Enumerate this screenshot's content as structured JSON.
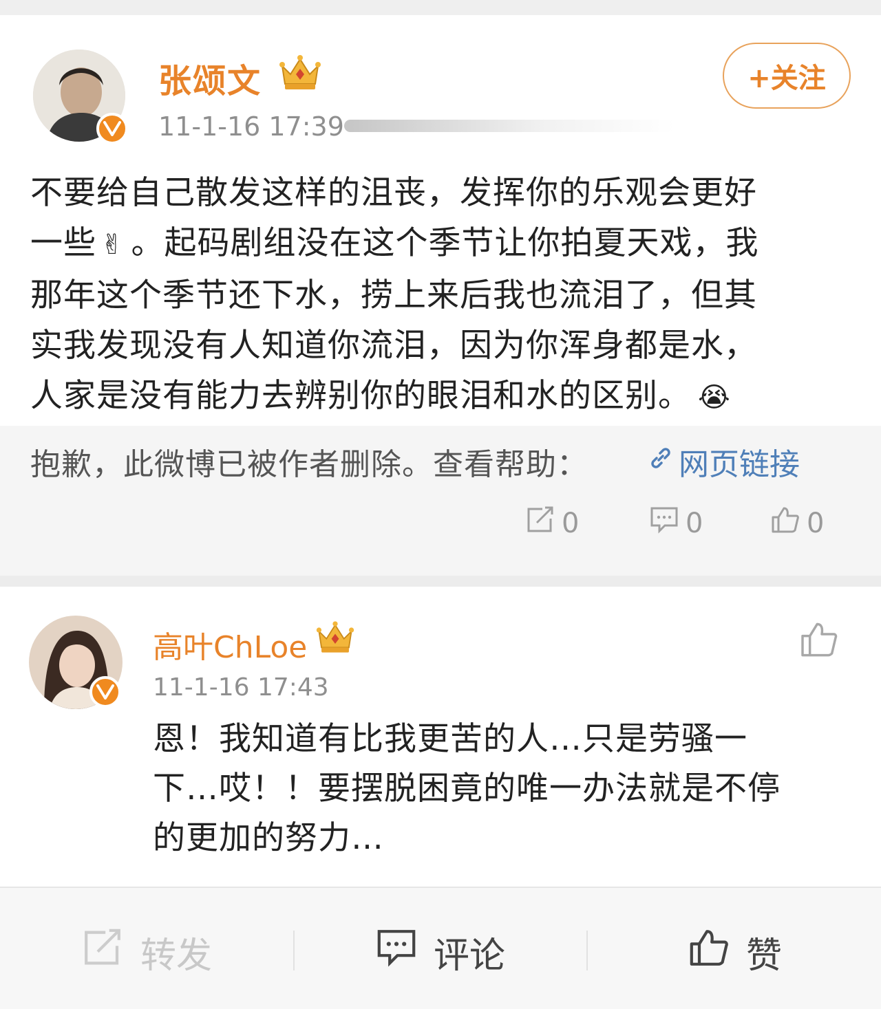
{
  "post": {
    "author": "张颂文",
    "timestamp": "11-1-16 17:39",
    "follow_label": "+关注",
    "text_lines": [
      "不要给自己散发这样的沮丧，发挥你的乐观会更好",
      "一些",
      "。起码剧组没在这个季节让你拍夏天戏，我",
      "那年这个季节还下水，捞上来后我也流泪了，但其",
      "实我发现没有人知道你流泪，因为你浑身都是水，",
      "人家是没有能力去辨别你的眼泪和水的区别。"
    ],
    "emoji_victory": "✌",
    "emoji_cry": "😭",
    "deleted_notice": "抱歉，此微博已被作者删除。查看帮助：",
    "link_label": "网页链接",
    "repost_count": "0",
    "comment_count": "0",
    "like_count": "0"
  },
  "comment": {
    "author": "高叶ChLoe",
    "timestamp": "11-1-16 17:43",
    "text_lines": [
      "恩！我知道有比我更苦的人…只是劳骚一",
      "下…哎！！要摆脱困竟的唯一办法就是不停",
      "的更加的努力…"
    ]
  },
  "action_bar": {
    "repost_label": "转发",
    "comment_label": "评论",
    "like_label": "赞"
  },
  "colors": {
    "username": "#e8832a",
    "link": "#4f7fb8",
    "badge": "#f08a1f"
  }
}
